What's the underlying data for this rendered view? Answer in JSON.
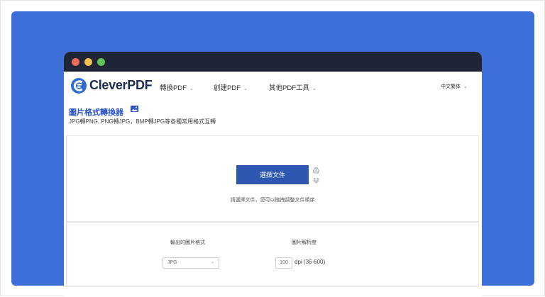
{
  "colors": {
    "page_bg": "#3f6fd8",
    "titlebar": "#1f2535",
    "accent": "#2e57b2",
    "title_blue": "#2a56c6"
  },
  "brand": {
    "name": "CleverPDF",
    "logo_icon": "cleverpdf-logo-icon"
  },
  "nav": {
    "items": [
      {
        "label": "轉換PDF"
      },
      {
        "label": "創建PDF"
      },
      {
        "label": "其他PDF工具"
      }
    ],
    "language": "中文繁体"
  },
  "page": {
    "title": "圖片格式轉換器",
    "title_icon": "image-icon",
    "subtitle": "JPG轉PNG, PNG轉JPG，BMP轉JPG等各種常用格式互轉"
  },
  "upload": {
    "button_label": "選擇文件",
    "side_icons": [
      "google-drive-icon",
      "dropbox-icon"
    ],
    "hint": "請選擇文件，您可以拖拽調整文件順序"
  },
  "options": {
    "format_label": "輸出的圖片格式",
    "format_value": "JPG",
    "resolution_label": "圖片解析度",
    "dpi_value": "100",
    "dpi_unit": "dpi (36-600)"
  }
}
